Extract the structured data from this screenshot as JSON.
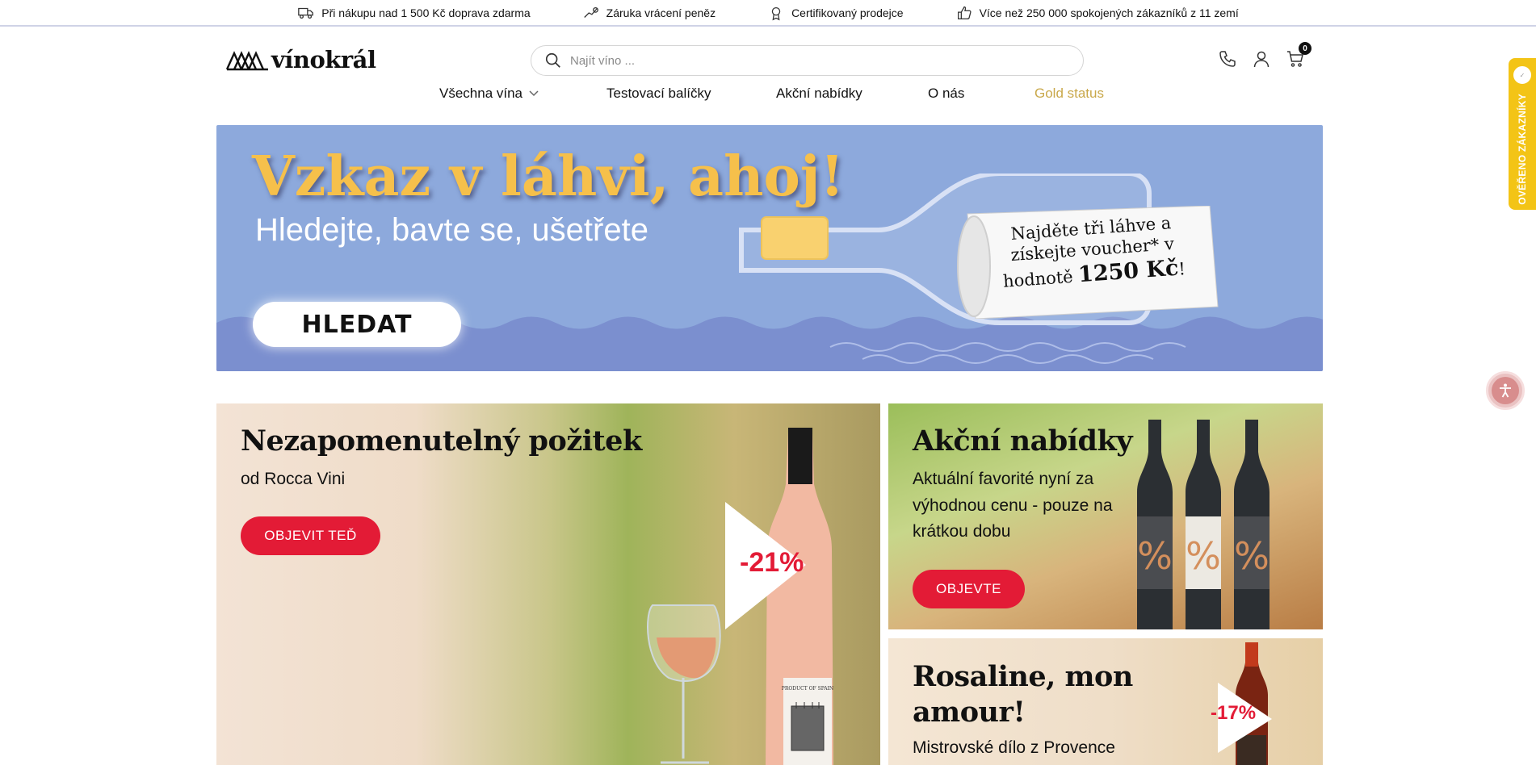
{
  "topbar": {
    "items": [
      {
        "icon": "truck-icon",
        "label": "Při nákupu nad 1 500 Kč doprava zdarma"
      },
      {
        "icon": "money-back-icon",
        "label": "Záruka vrácení peněz"
      },
      {
        "icon": "certificate-icon",
        "label": "Certifikovaný prodejce"
      },
      {
        "icon": "thumbs-up-icon",
        "label": "Více než 250 000 spokojených zákazníků z 11 zemí"
      }
    ]
  },
  "header": {
    "logo_text": "vínokrál",
    "search": {
      "placeholder": "Najít víno ..."
    },
    "cart_count": "0"
  },
  "nav": {
    "items": [
      {
        "label": "Všechna vína"
      },
      {
        "label": "Testovací balíčky"
      },
      {
        "label": "Akční nabídky"
      },
      {
        "label": "O nás"
      },
      {
        "label": "Gold status"
      }
    ]
  },
  "hero": {
    "title": "Vzkaz v láhvi, ahoj!",
    "subtitle": "Hledejte, bavte se, ušetřete",
    "button": "HLEDAT",
    "note_line1": "Najděte tři láhve a",
    "note_line2": "získejte voucher* v",
    "note_line3_prefix": "hodnotě",
    "note_amount": "1250 Kč",
    "note_suffix": "!"
  },
  "cards": [
    {
      "title": "Nezapomenutelný požitek",
      "text": "od Rocca Vini",
      "button": "OBJEVIT TEĎ",
      "discount": "-21%",
      "bottle_label": "PRODUCT OF SPAIN"
    },
    {
      "title": "Akční nabídky",
      "text": "Aktuální favorité nyní za výhodnou cenu - pouze na krátkou dobu",
      "button": "OBJEVTE",
      "percent": "%"
    },
    {
      "title": "Rosaline, mon amour!",
      "text": "Mistrovské dílo z Provence",
      "discount": "-17%"
    }
  ],
  "side": {
    "verified_text": "OVĚŘENO ZÁKAZNÍKY"
  },
  "colors": {
    "accent_red": "#e31b36",
    "gold": "#c9a84a",
    "hero_blue": "#8da9dc",
    "hero_yellow": "#f6c04b",
    "verified_yellow": "#f3c416"
  }
}
